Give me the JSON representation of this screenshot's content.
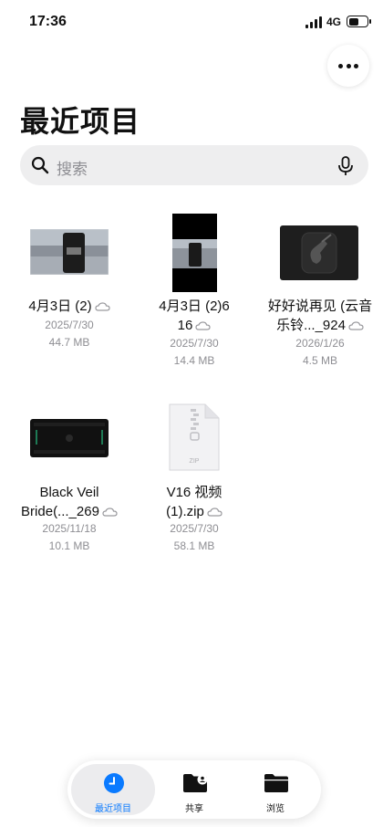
{
  "status": {
    "time": "17:36",
    "network": "4G"
  },
  "header": {
    "title": "最近项目"
  },
  "search": {
    "placeholder": "搜索"
  },
  "files": [
    {
      "name": "4月3日 (2)",
      "date": "2025/7/30",
      "size": "44.7 MB",
      "thumb": "video-landscape"
    },
    {
      "name_line1": "4月3日 (2)6",
      "name_line2": "16",
      "date": "2025/7/30",
      "size": "14.4 MB",
      "thumb": "video-portrait"
    },
    {
      "name_line1": "好好说再见 (云音",
      "name_line2": "乐铃..._924",
      "date": "2026/1/26",
      "size": "4.5 MB",
      "thumb": "garageband"
    },
    {
      "name_line1": "Black Veil",
      "name_line2": "Bride(..._269",
      "date": "2025/11/18",
      "size": "10.1 MB",
      "thumb": "dark-image"
    },
    {
      "name_line1": "V16 视频",
      "name_line2": "(1).zip",
      "date": "2025/7/30",
      "size": "58.1 MB",
      "thumb": "zip-file",
      "thumb_label": "ZIP"
    }
  ],
  "tabs": [
    {
      "label": "最近项目",
      "icon": "clock-icon",
      "active": true
    },
    {
      "label": "共享",
      "icon": "shared-folder-icon",
      "active": false
    },
    {
      "label": "浏览",
      "icon": "folder-icon",
      "active": false
    }
  ],
  "colors": {
    "accent": "#0a7aff",
    "secondary_text": "#8e8e93",
    "search_bg": "#eeeeef"
  }
}
